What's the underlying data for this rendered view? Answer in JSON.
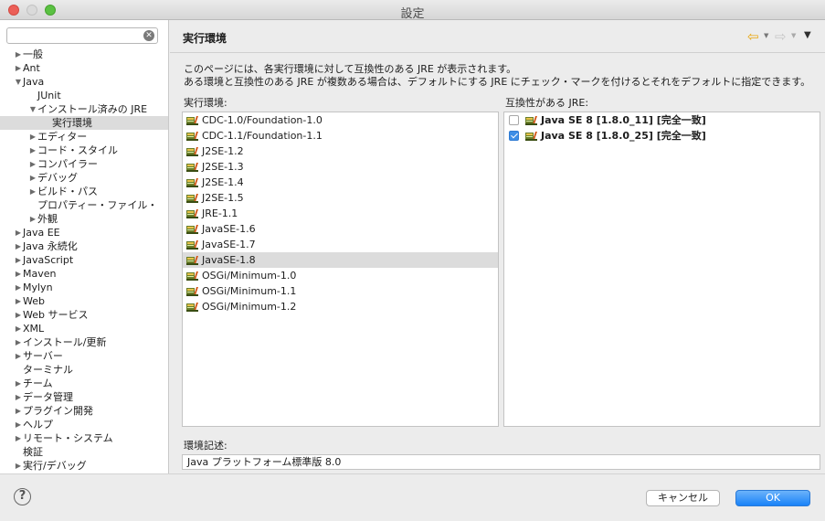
{
  "window": {
    "title": "設定"
  },
  "sidebar": {
    "search": {
      "value": "",
      "placeholder": ""
    },
    "tree": [
      {
        "label": "一般",
        "indent": 0,
        "twisty": "▶"
      },
      {
        "label": "Ant",
        "indent": 0,
        "twisty": "▶"
      },
      {
        "label": "Java",
        "indent": 0,
        "twisty": "▼"
      },
      {
        "label": "JUnit",
        "indent": 1,
        "twisty": ""
      },
      {
        "label": "インストール済みの JRE",
        "indent": 1,
        "twisty": "▼"
      },
      {
        "label": "実行環境",
        "indent": 2,
        "twisty": "",
        "selected": true
      },
      {
        "label": "エディター",
        "indent": 1,
        "twisty": "▶"
      },
      {
        "label": "コード・スタイル",
        "indent": 1,
        "twisty": "▶"
      },
      {
        "label": "コンパイラー",
        "indent": 1,
        "twisty": "▶"
      },
      {
        "label": "デバッグ",
        "indent": 1,
        "twisty": "▶"
      },
      {
        "label": "ビルド・パス",
        "indent": 1,
        "twisty": "▶"
      },
      {
        "label": "プロパティー・ファイル・",
        "indent": 1,
        "twisty": ""
      },
      {
        "label": "外観",
        "indent": 1,
        "twisty": "▶"
      },
      {
        "label": "Java EE",
        "indent": 0,
        "twisty": "▶"
      },
      {
        "label": "Java 永続化",
        "indent": 0,
        "twisty": "▶"
      },
      {
        "label": "JavaScript",
        "indent": 0,
        "twisty": "▶"
      },
      {
        "label": "Maven",
        "indent": 0,
        "twisty": "▶"
      },
      {
        "label": "Mylyn",
        "indent": 0,
        "twisty": "▶"
      },
      {
        "label": "Web",
        "indent": 0,
        "twisty": "▶"
      },
      {
        "label": "Web サービス",
        "indent": 0,
        "twisty": "▶"
      },
      {
        "label": "XML",
        "indent": 0,
        "twisty": "▶"
      },
      {
        "label": "インストール/更新",
        "indent": 0,
        "twisty": "▶"
      },
      {
        "label": "サーバー",
        "indent": 0,
        "twisty": "▶"
      },
      {
        "label": "ターミナル",
        "indent": 0,
        "twisty": ""
      },
      {
        "label": "チーム",
        "indent": 0,
        "twisty": "▶"
      },
      {
        "label": "データ管理",
        "indent": 0,
        "twisty": "▶"
      },
      {
        "label": "プラグイン開発",
        "indent": 0,
        "twisty": "▶"
      },
      {
        "label": "ヘルプ",
        "indent": 0,
        "twisty": "▶"
      },
      {
        "label": "リモート・システム",
        "indent": 0,
        "twisty": "▶"
      },
      {
        "label": "検証",
        "indent": 0,
        "twisty": ""
      },
      {
        "label": "実行/デバッグ",
        "indent": 0,
        "twisty": "▶"
      }
    ]
  },
  "page": {
    "title": "実行環境",
    "description_line1": "このページには、各実行環境に対して互換性のある JRE が表示されます。",
    "description_line2": "ある環境と互換性のある JRE が複数ある場合は、デフォルトにする JRE にチェック・マークを付けるとそれをデフォルトに指定できます。",
    "env_list_label": "実行環境:",
    "compat_list_label": "互換性がある JRE:",
    "env_desc_label": "環境記述:",
    "env_desc_value": "Java プラットフォーム標準版 8.0",
    "environments": [
      {
        "label": "CDC-1.0/Foundation-1.0"
      },
      {
        "label": "CDC-1.1/Foundation-1.1"
      },
      {
        "label": "J2SE-1.2"
      },
      {
        "label": "J2SE-1.3"
      },
      {
        "label": "J2SE-1.4"
      },
      {
        "label": "J2SE-1.5"
      },
      {
        "label": "JRE-1.1"
      },
      {
        "label": "JavaSE-1.6"
      },
      {
        "label": "JavaSE-1.7"
      },
      {
        "label": "JavaSE-1.8",
        "selected": true
      },
      {
        "label": "OSGi/Minimum-1.0"
      },
      {
        "label": "OSGi/Minimum-1.1"
      },
      {
        "label": "OSGi/Minimum-1.2"
      }
    ],
    "compatible_jres": [
      {
        "label": "Java SE 8 [1.8.0_11] [完全一致]",
        "checked": false
      },
      {
        "label": "Java SE 8 [1.8.0_25] [完全一致]",
        "checked": true
      }
    ]
  },
  "buttons": {
    "help": "?",
    "cancel": "キャンセル",
    "ok": "OK"
  },
  "colors": {
    "accent": "#1982f8",
    "selection": "#dcdcdc",
    "back_arrow": "#e9a60c"
  }
}
